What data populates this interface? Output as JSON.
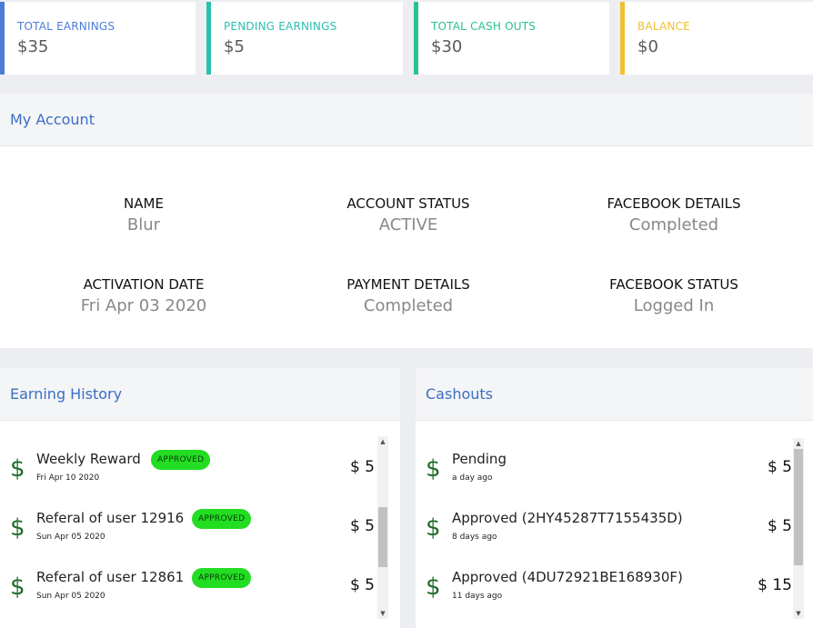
{
  "stats": [
    {
      "label": "TOTAL EARNINGS",
      "value": "$35",
      "color": "#4a7bd8"
    },
    {
      "label": "PENDING EARNINGS",
      "value": "$5",
      "color": "#2bbfb0"
    },
    {
      "label": "TOTAL CASH OUTS",
      "value": "$30",
      "color": "#28c38a"
    },
    {
      "label": "BALANCE",
      "value": "$0",
      "color": "#f0c030"
    }
  ],
  "account": {
    "title": "My Account",
    "fields": [
      {
        "key": "NAME",
        "value": "Blur"
      },
      {
        "key": "ACCOUNT STATUS",
        "value": "ACTIVE"
      },
      {
        "key": "FACEBOOK DETAILS",
        "value": "Completed"
      },
      {
        "key": "ACTIVATION DATE",
        "value": "Fri Apr 03 2020"
      },
      {
        "key": "PAYMENT DETAILS",
        "value": "Completed"
      },
      {
        "key": "FACEBOOK STATUS",
        "value": "Logged In"
      }
    ]
  },
  "earning_history": {
    "title": "Earning History",
    "items": [
      {
        "title": "Weekly Reward",
        "date": "Fri Apr 10 2020",
        "badge": "APPROVED",
        "amount": "$ 5"
      },
      {
        "title": "Referal of user 12916",
        "date": "Sun Apr 05 2020",
        "badge": "APPROVED",
        "amount": "$ 5"
      },
      {
        "title": "Referal of user 12861",
        "date": "Sun Apr 05 2020",
        "badge": "APPROVED",
        "amount": "$ 5"
      }
    ]
  },
  "cashouts": {
    "title": "Cashouts",
    "items": [
      {
        "title": "Pending",
        "date": "a day ago",
        "amount": "$ 5"
      },
      {
        "title": "Approved (2HY45287T7155435D)",
        "date": "8 days ago",
        "amount": "$ 5"
      },
      {
        "title": "Approved (4DU72921BE168930F)",
        "date": "11 days ago",
        "amount": "$ 15"
      }
    ]
  },
  "icons": {
    "dollar": "$",
    "scroll_up": "▲",
    "scroll_down": "▼"
  }
}
